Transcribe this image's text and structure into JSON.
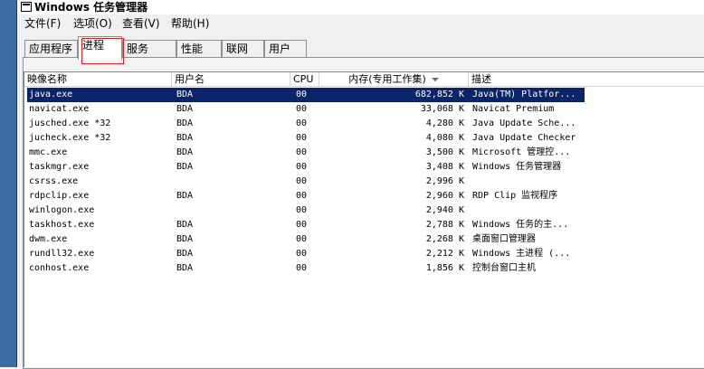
{
  "window": {
    "title": "Windows 任务管理器"
  },
  "menu": [
    {
      "label": "文件(F)"
    },
    {
      "label": "选项(O)"
    },
    {
      "label": "查看(V)"
    },
    {
      "label": "帮助(H)"
    }
  ],
  "tabs": [
    {
      "label": "应用程序"
    },
    {
      "label": "进程",
      "active": true
    },
    {
      "label": "服务"
    },
    {
      "label": "性能"
    },
    {
      "label": "联网"
    },
    {
      "label": "用户"
    }
  ],
  "table": {
    "columns": {
      "name": "映像名称",
      "user": "用户名",
      "cpu": "CPU",
      "memory": "内存(专用工作集)",
      "description": "描述"
    },
    "sorted_by": "memory",
    "sort_direction": "descending",
    "selected_row": 0,
    "rows": [
      {
        "name": "java.exe",
        "user": "BDA",
        "cpu": "00",
        "memory": "682,852 K",
        "description": "Java(TM) Platfor..."
      },
      {
        "name": "navicat.exe",
        "user": "BDA",
        "cpu": "00",
        "memory": "33,068 K",
        "description": "Navicat Premium"
      },
      {
        "name": "jusched.exe *32",
        "user": "BDA",
        "cpu": "00",
        "memory": "4,280 K",
        "description": "Java Update Sche..."
      },
      {
        "name": "jucheck.exe *32",
        "user": "BDA",
        "cpu": "00",
        "memory": "4,080 K",
        "description": "Java Update Checker"
      },
      {
        "name": "mmc.exe",
        "user": "BDA",
        "cpu": "00",
        "memory": "3,500 K",
        "description": "Microsoft 管理控..."
      },
      {
        "name": "taskmgr.exe",
        "user": "BDA",
        "cpu": "00",
        "memory": "3,408 K",
        "description": "Windows 任务管理器"
      },
      {
        "name": "csrss.exe",
        "user": "",
        "cpu": "00",
        "memory": "2,996 K",
        "description": ""
      },
      {
        "name": "rdpclip.exe",
        "user": "BDA",
        "cpu": "00",
        "memory": "2,960 K",
        "description": "RDP Clip 监视程序"
      },
      {
        "name": "winlogon.exe",
        "user": "",
        "cpu": "00",
        "memory": "2,940 K",
        "description": ""
      },
      {
        "name": "taskhost.exe",
        "user": "BDA",
        "cpu": "00",
        "memory": "2,788 K",
        "description": "Windows 任务的主..."
      },
      {
        "name": "dwm.exe",
        "user": "BDA",
        "cpu": "00",
        "memory": "2,268 K",
        "description": "桌面窗口管理器"
      },
      {
        "name": "rundll32.exe",
        "user": "BDA",
        "cpu": "00",
        "memory": "2,212 K",
        "description": "Windows 主进程 (..."
      },
      {
        "name": "conhost.exe",
        "user": "BDA",
        "cpu": "00",
        "memory": "1,856 K",
        "description": "控制台窗口主机"
      }
    ]
  },
  "colors": {
    "selection": "#0a246a",
    "annotation": "#e02020",
    "desktop": "#3b6ea5"
  }
}
